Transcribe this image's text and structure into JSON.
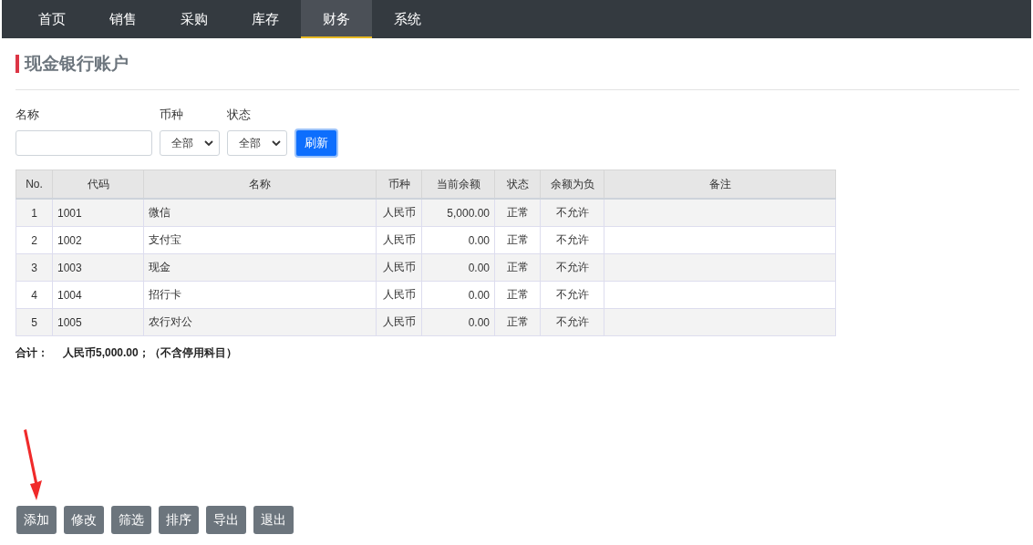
{
  "nav": {
    "tabs": [
      {
        "label": "首页",
        "selected": false
      },
      {
        "label": "销售",
        "selected": false
      },
      {
        "label": "采购",
        "selected": false
      },
      {
        "label": "库存",
        "selected": false
      },
      {
        "label": "财务",
        "selected": true
      },
      {
        "label": "系统",
        "selected": false
      }
    ]
  },
  "page_title": "现金银行账户",
  "filters": [
    {
      "kind": "text",
      "label": "名称"
    },
    {
      "kind": "select",
      "label": "币种",
      "value": "全部"
    },
    {
      "kind": "select",
      "label": "状态",
      "value": "全部"
    }
  ],
  "refresh_button": "刷新",
  "table": {
    "columns": [
      "No.",
      "代码",
      "名称",
      "币种",
      "当前余额",
      "状态",
      "余额为负",
      "备注"
    ],
    "rows": [
      [
        "1",
        "1001",
        "微信",
        "人民币",
        "5,000.00",
        "正常",
        "不允许",
        ""
      ],
      [
        "2",
        "1002",
        "支付宝",
        "人民币",
        "0.00",
        "正常",
        "不允许",
        ""
      ],
      [
        "3",
        "1003",
        "现金",
        "人民币",
        "0.00",
        "正常",
        "不允许",
        ""
      ],
      [
        "4",
        "1004",
        "招行卡",
        "人民币",
        "0.00",
        "正常",
        "不允许",
        ""
      ],
      [
        "5",
        "1005",
        "农行对公",
        "人民币",
        "0.00",
        "正常",
        "不允许",
        ""
      ]
    ]
  },
  "summary": {
    "label": "合计：",
    "value": "人民币5,000.00；（不含停用科目）"
  },
  "buttons": [
    "添加",
    "修改",
    "筛选",
    "排序",
    "导出",
    "退出"
  ]
}
